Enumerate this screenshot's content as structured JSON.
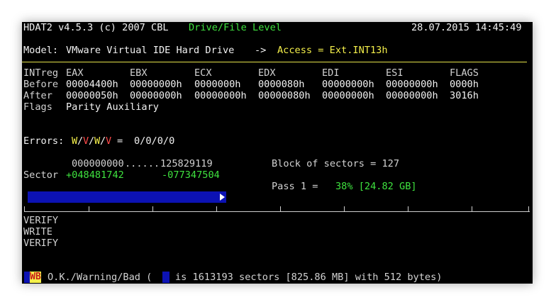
{
  "header": {
    "app": "HDAT2 v4.5.3 (c) 2007 CBL",
    "mode": "Drive/File Level",
    "datetime": "28.07.2015 14:45:49"
  },
  "model": {
    "label": "Model:",
    "name": "VMware Virtual IDE Hard Drive",
    "arrow": "->",
    "access": "Access = Ext.INT13h"
  },
  "registers": {
    "headers": [
      "INTreg",
      "EAX",
      "EBX",
      "ECX",
      "EDX",
      "EDI",
      "ESI",
      "FLAGS"
    ],
    "before": [
      "Before",
      "00004400h",
      "00000000h",
      "0000000h",
      "0000080h",
      "00000000h",
      "00000000h",
      "0000h"
    ],
    "after": [
      "After",
      "00000050h",
      "00000000h",
      "00000000h",
      "00000080h",
      "00000000h",
      "00000000h",
      "3016h"
    ],
    "flags_label": "Flags",
    "flags_value": "Parity Auxiliary"
  },
  "errors": {
    "label": "Errors:",
    "w1": "W",
    "v1": "V",
    "w2": "W",
    "v2": "V",
    "eq": "=",
    "values": "0/0/0/0",
    "slash": "/"
  },
  "range": {
    "start": "000000000",
    "dots": "......",
    "end": "125829119"
  },
  "sector": {
    "label": "Sector",
    "pos": "+048481742",
    "remaining": "-077347504"
  },
  "block": {
    "text": "Block of sectors = 127"
  },
  "pass": {
    "label": "Pass 1 =",
    "percent": "38% [24.82 GB]"
  },
  "progress": {
    "fraction": 0.38,
    "color": "#0c12b4"
  },
  "log": {
    "lines": [
      "VERIFY",
      "WRITE",
      "VERIFY"
    ]
  },
  "legend": {
    "badge": "WB",
    "text1": "O.K./Warning/Bad (",
    "text2": "is 1613193 sectors [825.86 MB] with 512 bytes)"
  }
}
